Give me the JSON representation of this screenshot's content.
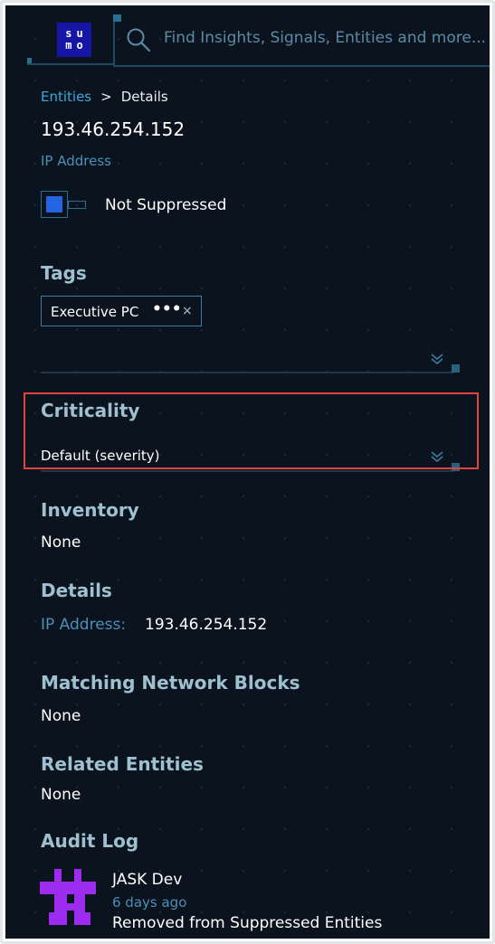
{
  "header": {
    "logo_top": "su",
    "logo_bottom": "mo",
    "search_placeholder": "Find Insights, Signals, Entities and more..."
  },
  "breadcrumb": {
    "root": "Entities",
    "separator": ">",
    "current": "Details"
  },
  "entity": {
    "name": "193.46.254.152",
    "type": "IP Address",
    "suppression_status": "Not Suppressed",
    "suppressed": false
  },
  "tags": {
    "title": "Tags",
    "items": [
      {
        "label": "Executive PC",
        "more": "•••",
        "remove": "×"
      }
    ]
  },
  "criticality": {
    "title": "Criticality",
    "value": "Default (severity)"
  },
  "inventory": {
    "title": "Inventory",
    "value": "None"
  },
  "details": {
    "title": "Details",
    "key": "IP Address:",
    "value": "193.46.254.152"
  },
  "matching_network_blocks": {
    "title": "Matching Network Blocks",
    "value": "None"
  },
  "related_entities": {
    "title": "Related Entities",
    "value": "None"
  },
  "audit_log": {
    "title": "Audit Log",
    "entries": [
      {
        "user": "JASK Dev",
        "time": "6 days ago",
        "action": "Removed from Suppressed Entities"
      }
    ]
  },
  "colors": {
    "background": "#0b141e",
    "accent_blue": "#2364e0",
    "link": "#3aa8d8",
    "section_title": "#9ec0d0",
    "highlight": "#e0443a",
    "avatar": "#9b2cf0"
  },
  "icons": [
    "search-icon",
    "close-icon",
    "more-icon",
    "chevron-down-icon",
    "avatar-icon"
  ]
}
